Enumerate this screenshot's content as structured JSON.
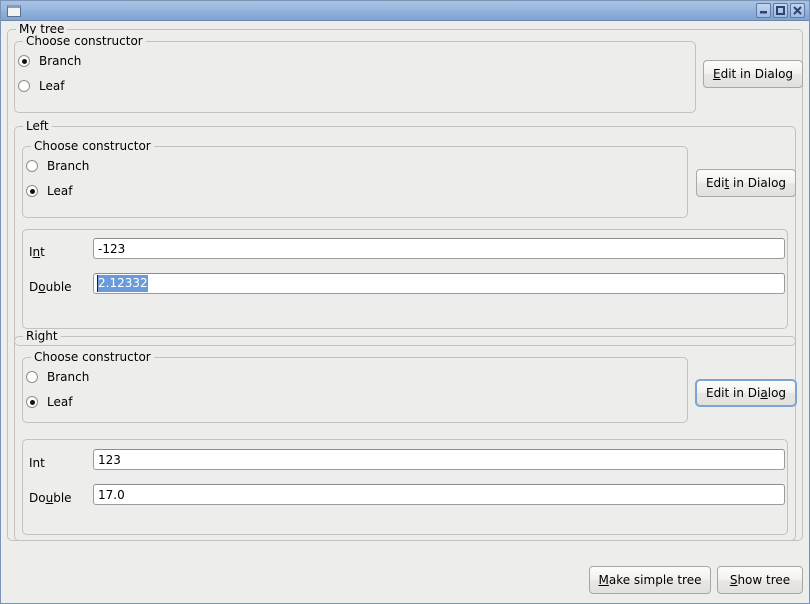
{
  "window": {
    "title": "",
    "icon": "window-icon",
    "controls": [
      {
        "name": "minimize-button",
        "glyph": "minimize"
      },
      {
        "name": "maximize-button",
        "glyph": "maximize"
      },
      {
        "name": "close-button",
        "glyph": "close"
      }
    ]
  },
  "colors": {
    "background": "#ededeb",
    "titlebar_top": "#a8c2e4",
    "titlebar_bottom": "#7fa3d2",
    "group_border": "#c3c2bf",
    "selection": "#6a9bd8",
    "focus_ring": "#7ba3d4",
    "input_background": "#ffffff"
  },
  "root_group": {
    "legend": "My tree",
    "constructor_group": {
      "legend": "Choose constructor",
      "options": [
        {
          "label": "Branch",
          "selected": true
        },
        {
          "label": "Leaf",
          "selected": false
        }
      ]
    },
    "edit_button": {
      "text": "Edit in Dialog",
      "mnemonic_index": 0,
      "focused": false
    }
  },
  "left_group": {
    "legend": "Left",
    "constructor_group": {
      "legend": "Choose constructor",
      "options": [
        {
          "label": "Branch",
          "selected": false
        },
        {
          "label": "Leaf",
          "selected": true
        }
      ]
    },
    "edit_button": {
      "text": "Edit in Dialog",
      "mnemonic_index": 3,
      "focused": false
    },
    "fields": [
      {
        "label": "Int",
        "mnemonic_index": 1,
        "value": "-123",
        "selected": false
      },
      {
        "label": "Double",
        "mnemonic_index": 1,
        "value": "2.12332",
        "selected": true
      }
    ]
  },
  "right_group": {
    "legend": "Right",
    "constructor_group": {
      "legend": "Choose constructor",
      "options": [
        {
          "label": "Branch",
          "selected": false
        },
        {
          "label": "Leaf",
          "selected": true
        }
      ]
    },
    "edit_button": {
      "text": "Edit in Dialog",
      "mnemonic_index": 10,
      "focused": true
    },
    "fields": [
      {
        "label": "Int",
        "mnemonic_index": -1,
        "value": "123",
        "selected": false
      },
      {
        "label": "Double",
        "mnemonic_index": 2,
        "value": "17.0",
        "selected": false
      }
    ]
  },
  "footer": {
    "buttons": [
      {
        "name": "make-simple-tree-button",
        "text": "Make simple tree",
        "mnemonic_index": 0
      },
      {
        "name": "show-tree-button",
        "text": "Show tree",
        "mnemonic_index": 0
      }
    ]
  }
}
